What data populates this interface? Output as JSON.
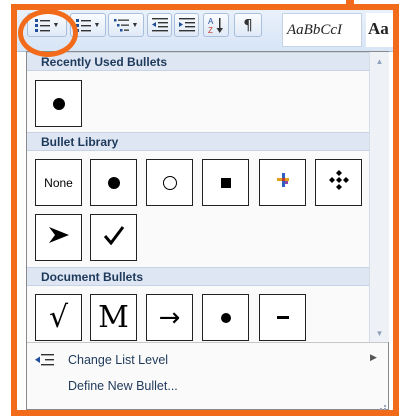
{
  "ribbon": {
    "style_sample": "AaBbCcI",
    "style_sample_2": "Aa"
  },
  "gallery": {
    "recently_used_header": "Recently Used Bullets",
    "library_header": "Bullet Library",
    "document_header": "Document Bullets",
    "library_none_label": "None",
    "document_glyphs": [
      "√",
      "M",
      "→"
    ]
  },
  "menu": {
    "change_list_level": "Change List Level",
    "define_new_bullet": "Define New Bullet..."
  },
  "colors": {
    "highlight": "#f26b1a",
    "header_bg": "#dde6f2",
    "header_text": "#1e395b"
  },
  "icons": [
    "bullets-icon",
    "numbering-icon",
    "multilevel-list-icon",
    "decrease-indent-icon",
    "increase-indent-icon",
    "sort-icon",
    "pilcrow-icon",
    "change-list-level-icon",
    "resize-grip-icon"
  ]
}
